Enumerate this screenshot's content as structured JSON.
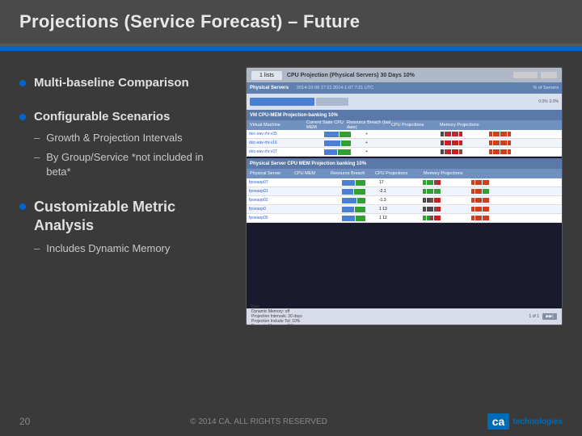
{
  "slide": {
    "title": "Projections (Service Forecast) – Future",
    "accent_color": "#0066cc"
  },
  "bullets": [
    {
      "id": "bullet-1",
      "text": "Multi-baseline Comparison",
      "sub_items": []
    },
    {
      "id": "bullet-2",
      "text": "Configurable Scenarios",
      "sub_items": [
        {
          "id": "sub-1",
          "text": "Growth & Projection Intervals"
        },
        {
          "id": "sub-2",
          "text": "By Group/Service  *not included in beta*"
        }
      ]
    },
    {
      "id": "bullet-3",
      "text": "Customizable Metric Analysis",
      "sub_items": [
        {
          "id": "sub-3",
          "text": "Includes Dynamic Memory"
        }
      ]
    }
  ],
  "screenshot": {
    "title": "CPU Projection (Physical Servers) 30 Days 10%",
    "section2_title": "VM CPU-MEM Projection-banking 10%",
    "section3_title": "Physical Server CPU MEM Projection banking 10%",
    "table_headers": [
      "Virtual Machine",
      "Current State (CPU-MEM)",
      "Resource Breach (next date)",
      "CPU Projections",
      "Memory Projections"
    ]
  },
  "footer": {
    "page_number": "20",
    "copyright": "© 2014 CA. ALL RIGHTS RESERVED"
  },
  "logo": {
    "ca_text": "ca",
    "tech_text": "technologies"
  }
}
